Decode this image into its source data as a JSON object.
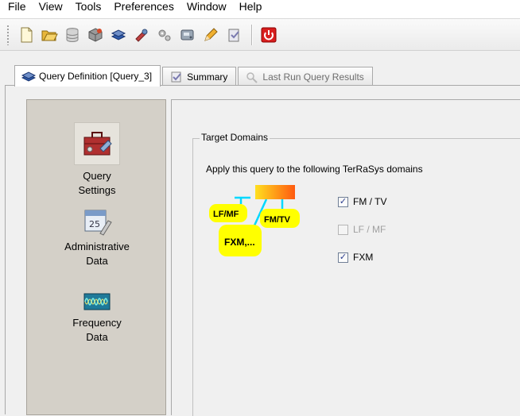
{
  "menu": [
    "File",
    "View",
    "Tools",
    "Preferences",
    "Window",
    "Help"
  ],
  "tabs": [
    {
      "label": "Query Definition [Query_3]"
    },
    {
      "label": "Summary"
    },
    {
      "label": "Last Run Query Results"
    }
  ],
  "nav": [
    {
      "label": "Query Settings"
    },
    {
      "label": "Administrative Data"
    },
    {
      "label": "Frequency Data"
    }
  ],
  "target": {
    "title": "Target Domains",
    "description": "Apply this query to the following TerRaSys domains",
    "diagram_labels": [
      "LF/MF",
      "FM/TV",
      "FXM,..."
    ],
    "options": [
      {
        "label": "FM / TV",
        "checked": true,
        "enabled": true
      },
      {
        "label": "LF / MF",
        "checked": false,
        "enabled": false
      },
      {
        "label": "FXM",
        "checked": true,
        "enabled": true
      }
    ]
  }
}
